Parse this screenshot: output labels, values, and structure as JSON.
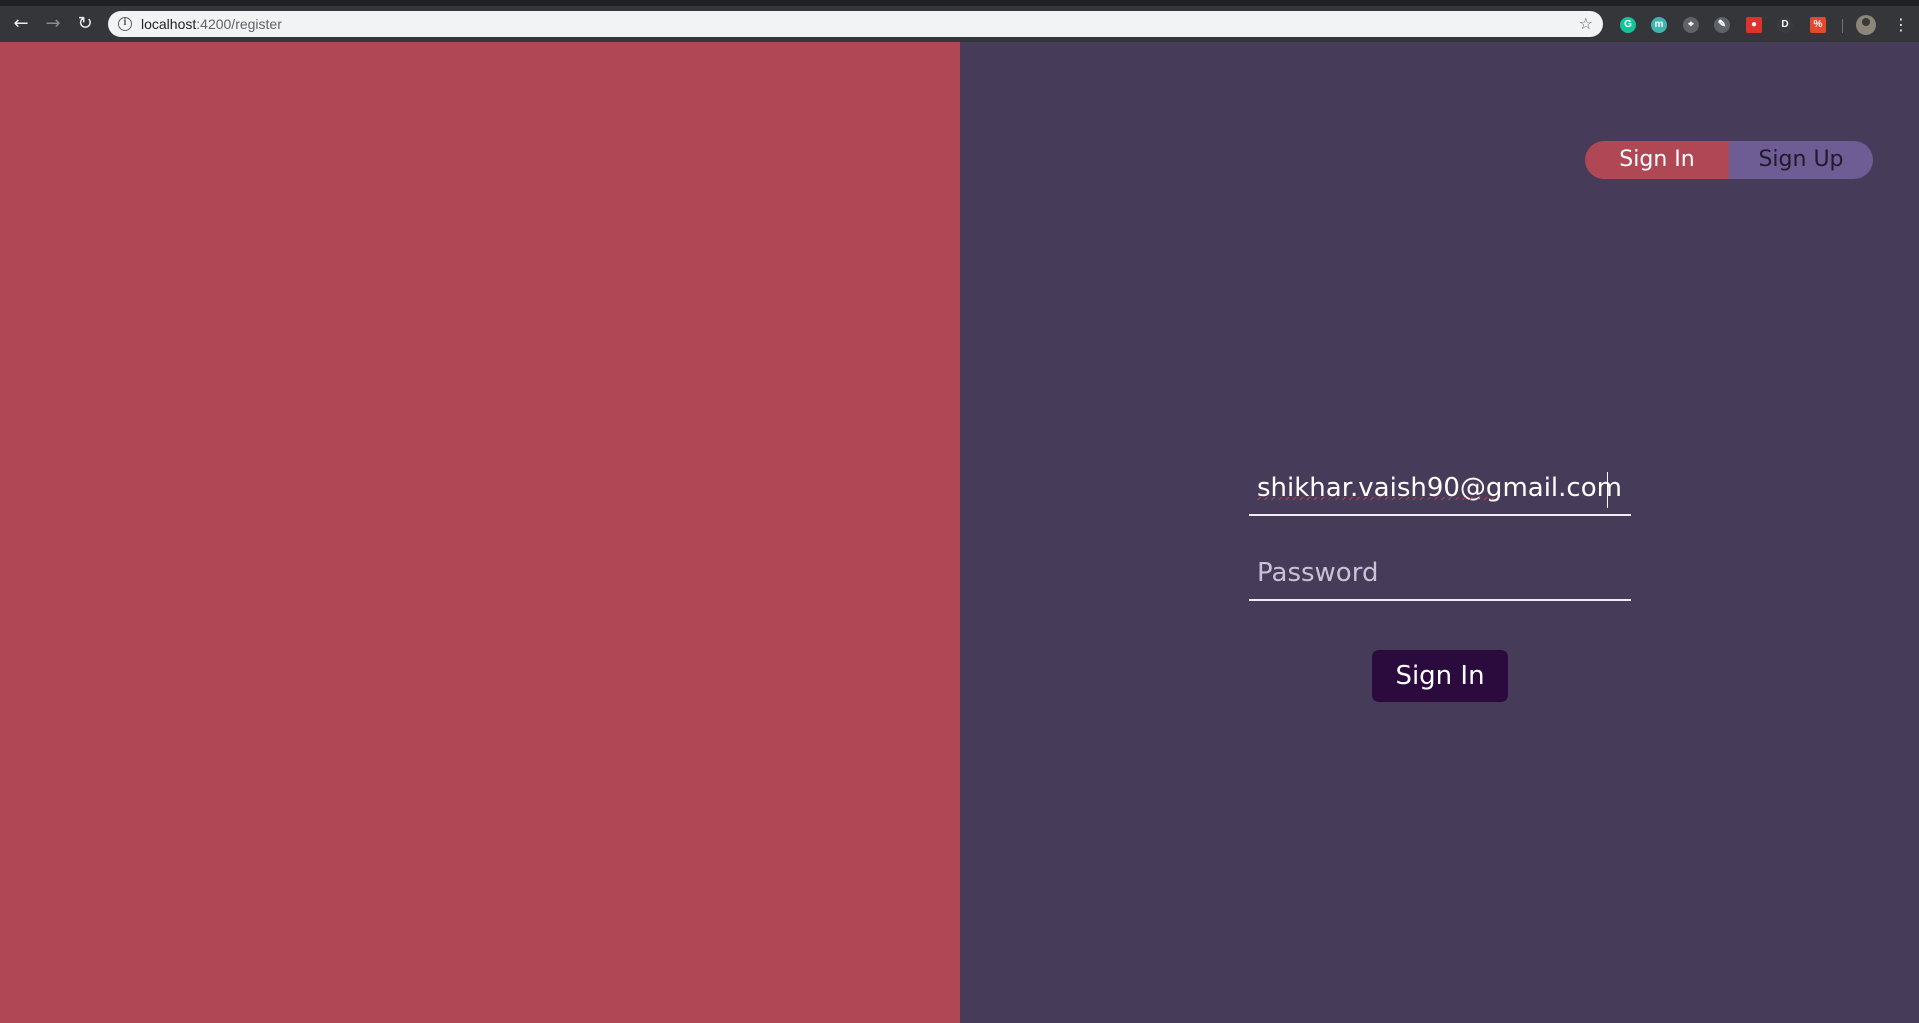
{
  "browser": {
    "url_host": "localhost",
    "url_rest": ":4200/register",
    "extensions": [
      {
        "icon": "grammarly-icon",
        "color": "#15c39a",
        "glyph": "G"
      },
      {
        "icon": "m-extension-icon",
        "color": "#3fb5b0",
        "glyph": "m"
      },
      {
        "icon": "location-pin-icon",
        "color": "#5f6368",
        "glyph": "⌖"
      },
      {
        "icon": "pen-icon",
        "color": "#5f6368",
        "glyph": "✎"
      },
      {
        "icon": "red-shield-icon",
        "color": "#e0322c",
        "glyph": "●"
      },
      {
        "icon": "dark-reader-icon",
        "color": "#3a3b3e",
        "glyph": "D"
      },
      {
        "icon": "percent-icon",
        "color": "#e5482d",
        "glyph": "%"
      }
    ]
  },
  "colors": {
    "left_panel": "#b04755",
    "right_panel": "#463b58",
    "toggle_signup": "#6e5d94",
    "submit_button": "#2b0a3d"
  },
  "auth": {
    "toggle": {
      "signin_label": "Sign In",
      "signup_label": "Sign Up"
    },
    "email": {
      "value": "shikhar.vaish90@gmail.com"
    },
    "password": {
      "value": "",
      "placeholder": "Password"
    },
    "submit_label": "Sign In"
  }
}
